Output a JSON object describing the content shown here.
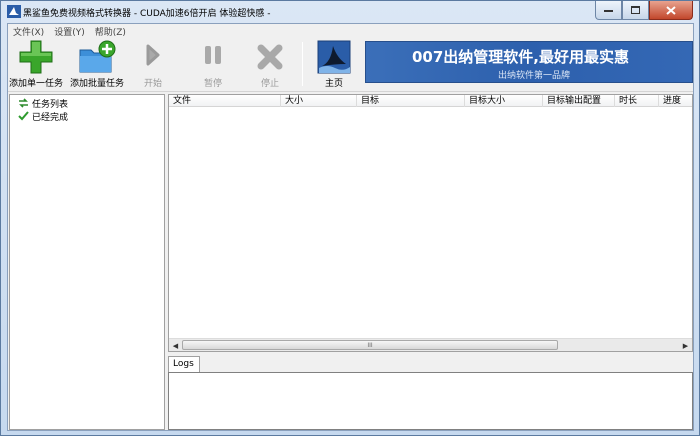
{
  "window": {
    "title": "黑鲨鱼免费视频格式转换器 - CUDA加速6倍开启 体验超快感 -"
  },
  "menu": [
    {
      "label": "文件(X)"
    },
    {
      "label": "设置(Y)"
    },
    {
      "label": "帮助(Z)"
    }
  ],
  "toolbar": {
    "add_single": "添加单一任务",
    "add_batch": "添加批量任务",
    "start": "开始",
    "pause": "暂停",
    "stop": "停止",
    "home": "主页"
  },
  "banner": {
    "title": "007出纳管理软件,最好用最实惠",
    "subtitle": "出纳软件第一品牌"
  },
  "tree": {
    "items": [
      {
        "label": "任务列表",
        "icon": "refresh-arrows-icon"
      },
      {
        "label": "已经完成",
        "icon": "checkmark-icon"
      }
    ]
  },
  "list": {
    "columns": [
      "文件",
      "大小",
      "目标",
      "目标大小",
      "目标输出配置",
      "时长",
      "进度"
    ],
    "scroll_grip": "III"
  },
  "logs": {
    "tab": "Logs"
  },
  "colors": {
    "banner_bg": "#2d60ad",
    "add_green": "#3aa62b",
    "folder_blue": "#3d8fd8",
    "disabled_gray": "#9a9a9a"
  }
}
